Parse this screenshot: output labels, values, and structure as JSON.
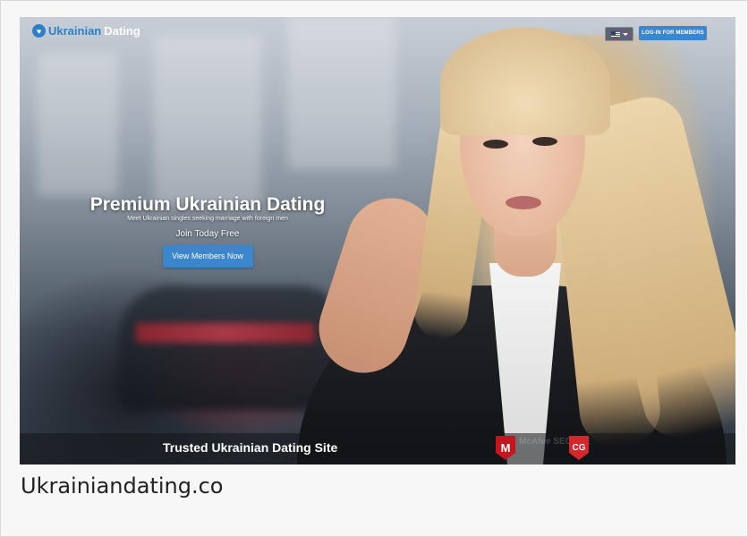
{
  "header": {
    "logo_part1": "Ukrainian",
    "logo_part2": "Dating",
    "login_label": "LOG-IN FOR MEMBERS",
    "language_icon": "us-flag-icon"
  },
  "hero": {
    "title": "Premium Ukrainian Dating",
    "subtitle": "Meet Ukrainian singles seeking marriage with foreign men",
    "join_text": "Join Today Free",
    "cta_label": "View Members Now"
  },
  "trust_bar": {
    "text": "Trusted Ukrainian Dating Site",
    "badge1_letter": "M",
    "badge1_text": "McAfee SECURE",
    "badge2_letter": "CG"
  },
  "caption": "Ukrainiandating.co",
  "colors": {
    "accent_blue": "#3b86cc",
    "badge_red": "#c4161c"
  }
}
